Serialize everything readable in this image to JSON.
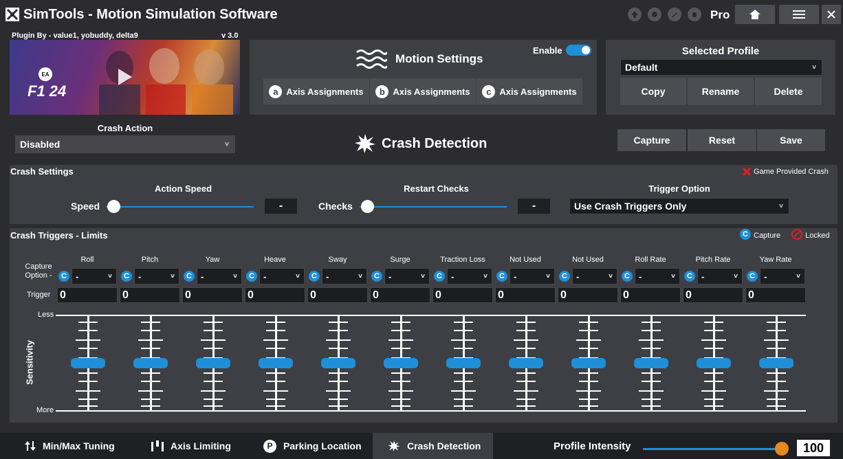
{
  "titlebar": {
    "app_name": "SimTools",
    "title": " - Motion Simulation Software",
    "edition": "Pro",
    "toolbar_icons": [
      "up-arrow-icon",
      "gear-badge-icon",
      "pencil-icon",
      "hand-icon"
    ]
  },
  "plugin": {
    "credit": "Plugin By - value1, yobuddy, delta9",
    "version": "v 3.0",
    "game_logo": "F1 24"
  },
  "motion": {
    "title": "Motion Settings",
    "enable_label": "Enable",
    "axis_buttons": [
      {
        "badge": "a",
        "label": "Axis Assignments"
      },
      {
        "badge": "b",
        "label": "Axis Assignments"
      },
      {
        "badge": "c",
        "label": "Axis Assignments"
      }
    ]
  },
  "profile": {
    "title": "Selected Profile",
    "selected": "Default",
    "copy": "Copy",
    "rename": "Rename",
    "delete": "Delete"
  },
  "crash_action": {
    "label": "Crash Action",
    "value": "Disabled"
  },
  "crash_detection_title": "Crash Detection",
  "actions": {
    "capture": "Capture",
    "reset": "Reset",
    "save": "Save"
  },
  "crash_settings": {
    "title": "Crash Settings",
    "game_provided": "Game Provided Crash",
    "action_speed_title": "Action Speed",
    "speed_label": "Speed",
    "speed_value": "-",
    "restart_title": "Restart Checks",
    "checks_label": "Checks",
    "checks_value": "-",
    "trigger_option_title": "Trigger Option",
    "trigger_option_value": "Use Crash Triggers Only"
  },
  "triggers": {
    "title": "Crash Triggers - Limits",
    "legend_capture": "Capture",
    "legend_locked": "Locked",
    "capture_option_label": "Capture\nOption -",
    "trigger_label": "Trigger",
    "less": "Less",
    "more": "More",
    "sensitivity": "Sensitivity",
    "columns": [
      {
        "name": "Roll",
        "option": "-",
        "trigger": "0"
      },
      {
        "name": "Pitch",
        "option": "-",
        "trigger": "0"
      },
      {
        "name": "Yaw",
        "option": "-",
        "trigger": "0"
      },
      {
        "name": "Heave",
        "option": "-",
        "trigger": "0"
      },
      {
        "name": "Sway",
        "option": "-",
        "trigger": "0"
      },
      {
        "name": "Surge",
        "option": "-",
        "trigger": "0"
      },
      {
        "name": "Traction Loss",
        "option": "-",
        "trigger": "0"
      },
      {
        "name": "Not Used",
        "option": "-",
        "trigger": "0"
      },
      {
        "name": "Not Used",
        "option": "-",
        "trigger": "0"
      },
      {
        "name": "Roll Rate",
        "option": "-",
        "trigger": "0"
      },
      {
        "name": "Pitch Rate",
        "option": "-",
        "trigger": "0"
      },
      {
        "name": "Yaw Rate",
        "option": "-",
        "trigger": "0"
      }
    ]
  },
  "bottom": {
    "tabs": [
      "Min/Max Tuning",
      "Axis Limiting",
      "Parking Location",
      "Crash Detection"
    ],
    "intensity_label": "Profile Intensity",
    "intensity_value": "100",
    "intensity_fraction": 1.0
  },
  "colors": {
    "accent": "#1e8fd8",
    "slider_orange": "#e8871e",
    "locked_red": "#e02020"
  }
}
